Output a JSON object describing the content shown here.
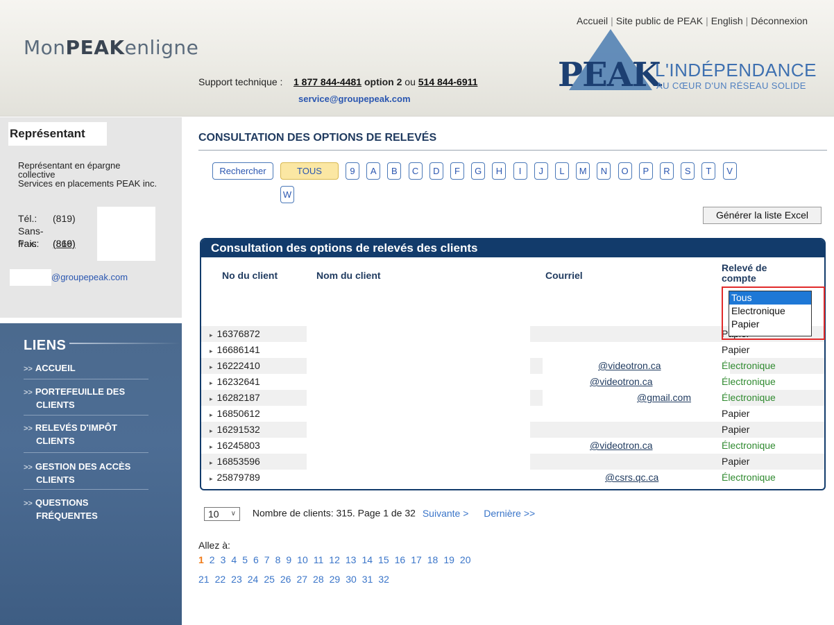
{
  "header": {
    "logo": {
      "prefix": "Mon",
      "bold": "PEAK",
      "suffix": "enligne"
    },
    "top_links": [
      "Accueil",
      "Site public de PEAK",
      "English",
      "Déconnexion"
    ],
    "support": {
      "label": "Support technique :",
      "phone1": "1 877 844-4481",
      "option": "option 2",
      "or": "ou",
      "phone2": "514 844-6911",
      "email": "service@groupepeak.com"
    },
    "brand": {
      "name": "PEAK",
      "tagline1": "L'INDÉPENDANCE",
      "tagline2": "AU CŒUR D'UN RÉSEAU SOLIDE"
    }
  },
  "sidebar": {
    "rep_title": "Représentant",
    "rep_line1": "Représentant en épargne",
    "rep_line2": "collective",
    "rep_line3": "Services en placements PEAK inc.",
    "tel_label": "Tél.:",
    "tel_value": "(819)",
    "sans_frais_label": "Sans-frais:",
    "sans_frais_value": "(866)",
    "fax_label": "Fax:",
    "fax_value": "(819)",
    "email_suffix": "@groupepeak.com",
    "links_title": "LIENS",
    "nav": [
      {
        "line1": "ACCUEIL",
        "line2": ""
      },
      {
        "line1": "PORTEFEUILLE DES",
        "line2": "CLIENTS"
      },
      {
        "line1": "RELEVÉS D'IMPÔT",
        "line2": "CLIENTS"
      },
      {
        "line1": "GESTION DES ACCÈS",
        "line2": "CLIENTS"
      },
      {
        "line1": "QUESTIONS",
        "line2": "FRÉQUENTES"
      }
    ]
  },
  "main": {
    "page_title": "CONSULTATION DES OPTIONS DE RELEVÉS",
    "search_button": "Rechercher",
    "all_button": "TOUS",
    "letters": [
      "9",
      "A",
      "B",
      "C",
      "D",
      "F",
      "G",
      "H",
      "I",
      "J",
      "L",
      "M",
      "N",
      "O",
      "P",
      "R",
      "S",
      "T",
      "V",
      "W"
    ],
    "excel_button": "Générer la liste Excel",
    "table": {
      "title": "Consultation des options de relevés des clients",
      "headers": {
        "no": "No du client",
        "name": "Nom du client",
        "email": "Courriel",
        "stmt1": "Relevé de",
        "stmt2": "compte"
      },
      "rows": [
        {
          "no": "16376872",
          "email": "",
          "stmt": "Papier"
        },
        {
          "no": "16686141",
          "email": "",
          "stmt": "Papier"
        },
        {
          "no": "16222410",
          "email": "@videotron.ca",
          "stmt": "Électronique"
        },
        {
          "no": "16232641",
          "email": "@videotron.ca",
          "stmt": "Électronique"
        },
        {
          "no": "16282187",
          "email": "@gmail.com",
          "stmt": "Électronique"
        },
        {
          "no": "16850612",
          "email": "",
          "stmt": "Papier"
        },
        {
          "no": "16291532",
          "email": "",
          "stmt": "Papier"
        },
        {
          "no": "16245803",
          "email": "@videotron.ca",
          "stmt": "Électronique"
        },
        {
          "no": "16853596",
          "email": "",
          "stmt": "Papier"
        },
        {
          "no": "25879789",
          "email": "@csrs.qc.ca",
          "stmt": "Électronique"
        }
      ]
    },
    "filter_dropdown": {
      "options": [
        "Tous",
        "Electronique",
        "Papier"
      ],
      "selected": "Tous"
    },
    "pager": {
      "per_page": "10",
      "summary": "Nombre de clients: 315. Page 1 de 32",
      "next": "Suivante >",
      "last": "Dernière >>",
      "goto_label": "Allez à:",
      "current_page": "1",
      "pages_row1": [
        "1",
        "2",
        "3",
        "4",
        "5",
        "6",
        "7",
        "8",
        "9",
        "10",
        "11",
        "12",
        "13",
        "14",
        "15",
        "16",
        "17",
        "18",
        "19",
        "20"
      ],
      "pages_row2": [
        "21",
        "22",
        "23",
        "24",
        "25",
        "26",
        "27",
        "28",
        "29",
        "30",
        "31",
        "32"
      ]
    }
  }
}
